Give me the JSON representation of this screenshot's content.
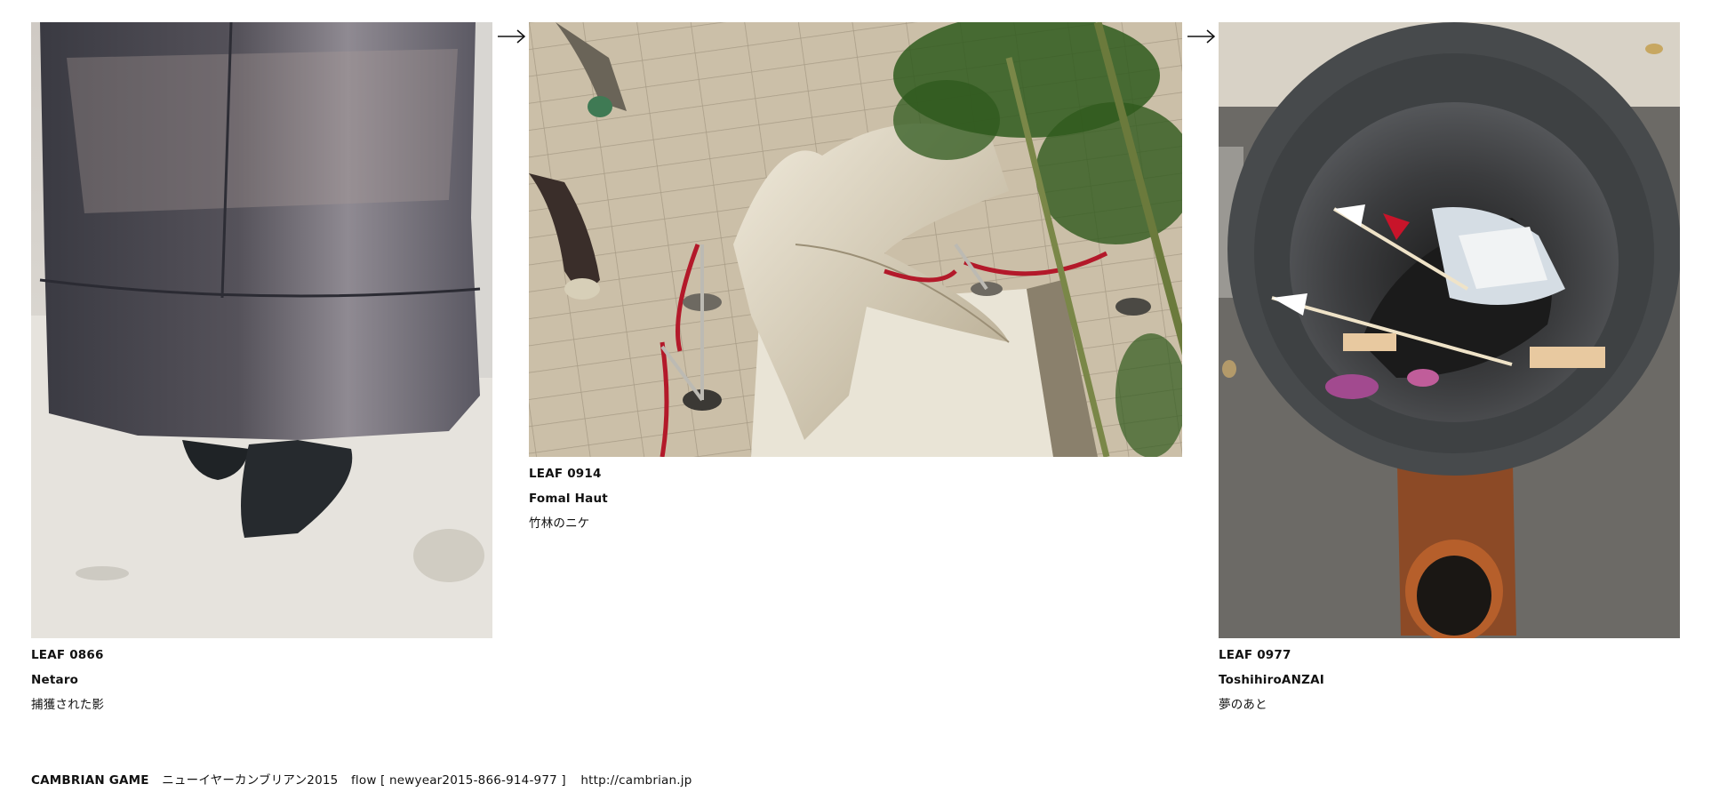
{
  "leaves": [
    {
      "code": "LEAF 0866",
      "author": "Netaro",
      "title": "捕獲された影",
      "image": "photo-coat-shadow"
    },
    {
      "code": "LEAF 0914",
      "author": "Fomal Haut",
      "title": "竹林のニケ",
      "image": "photo-winged-statue"
    },
    {
      "code": "LEAF 0977",
      "author": "ToshihiroANZAI",
      "title": "夢のあと",
      "image": "photo-burn-barrel"
    }
  ],
  "arrows": [
    "right-arrow-icon",
    "right-arrow-icon"
  ],
  "footer": {
    "title": "CAMBRIAN GAME",
    "subtitle": "ニューイヤーカンブリアン2015",
    "flow": "flow [ newyear2015-866-914-977 ]",
    "url": "http://cambrian.jp"
  },
  "colors": {
    "background": "#ffffff",
    "text": "#111111"
  }
}
